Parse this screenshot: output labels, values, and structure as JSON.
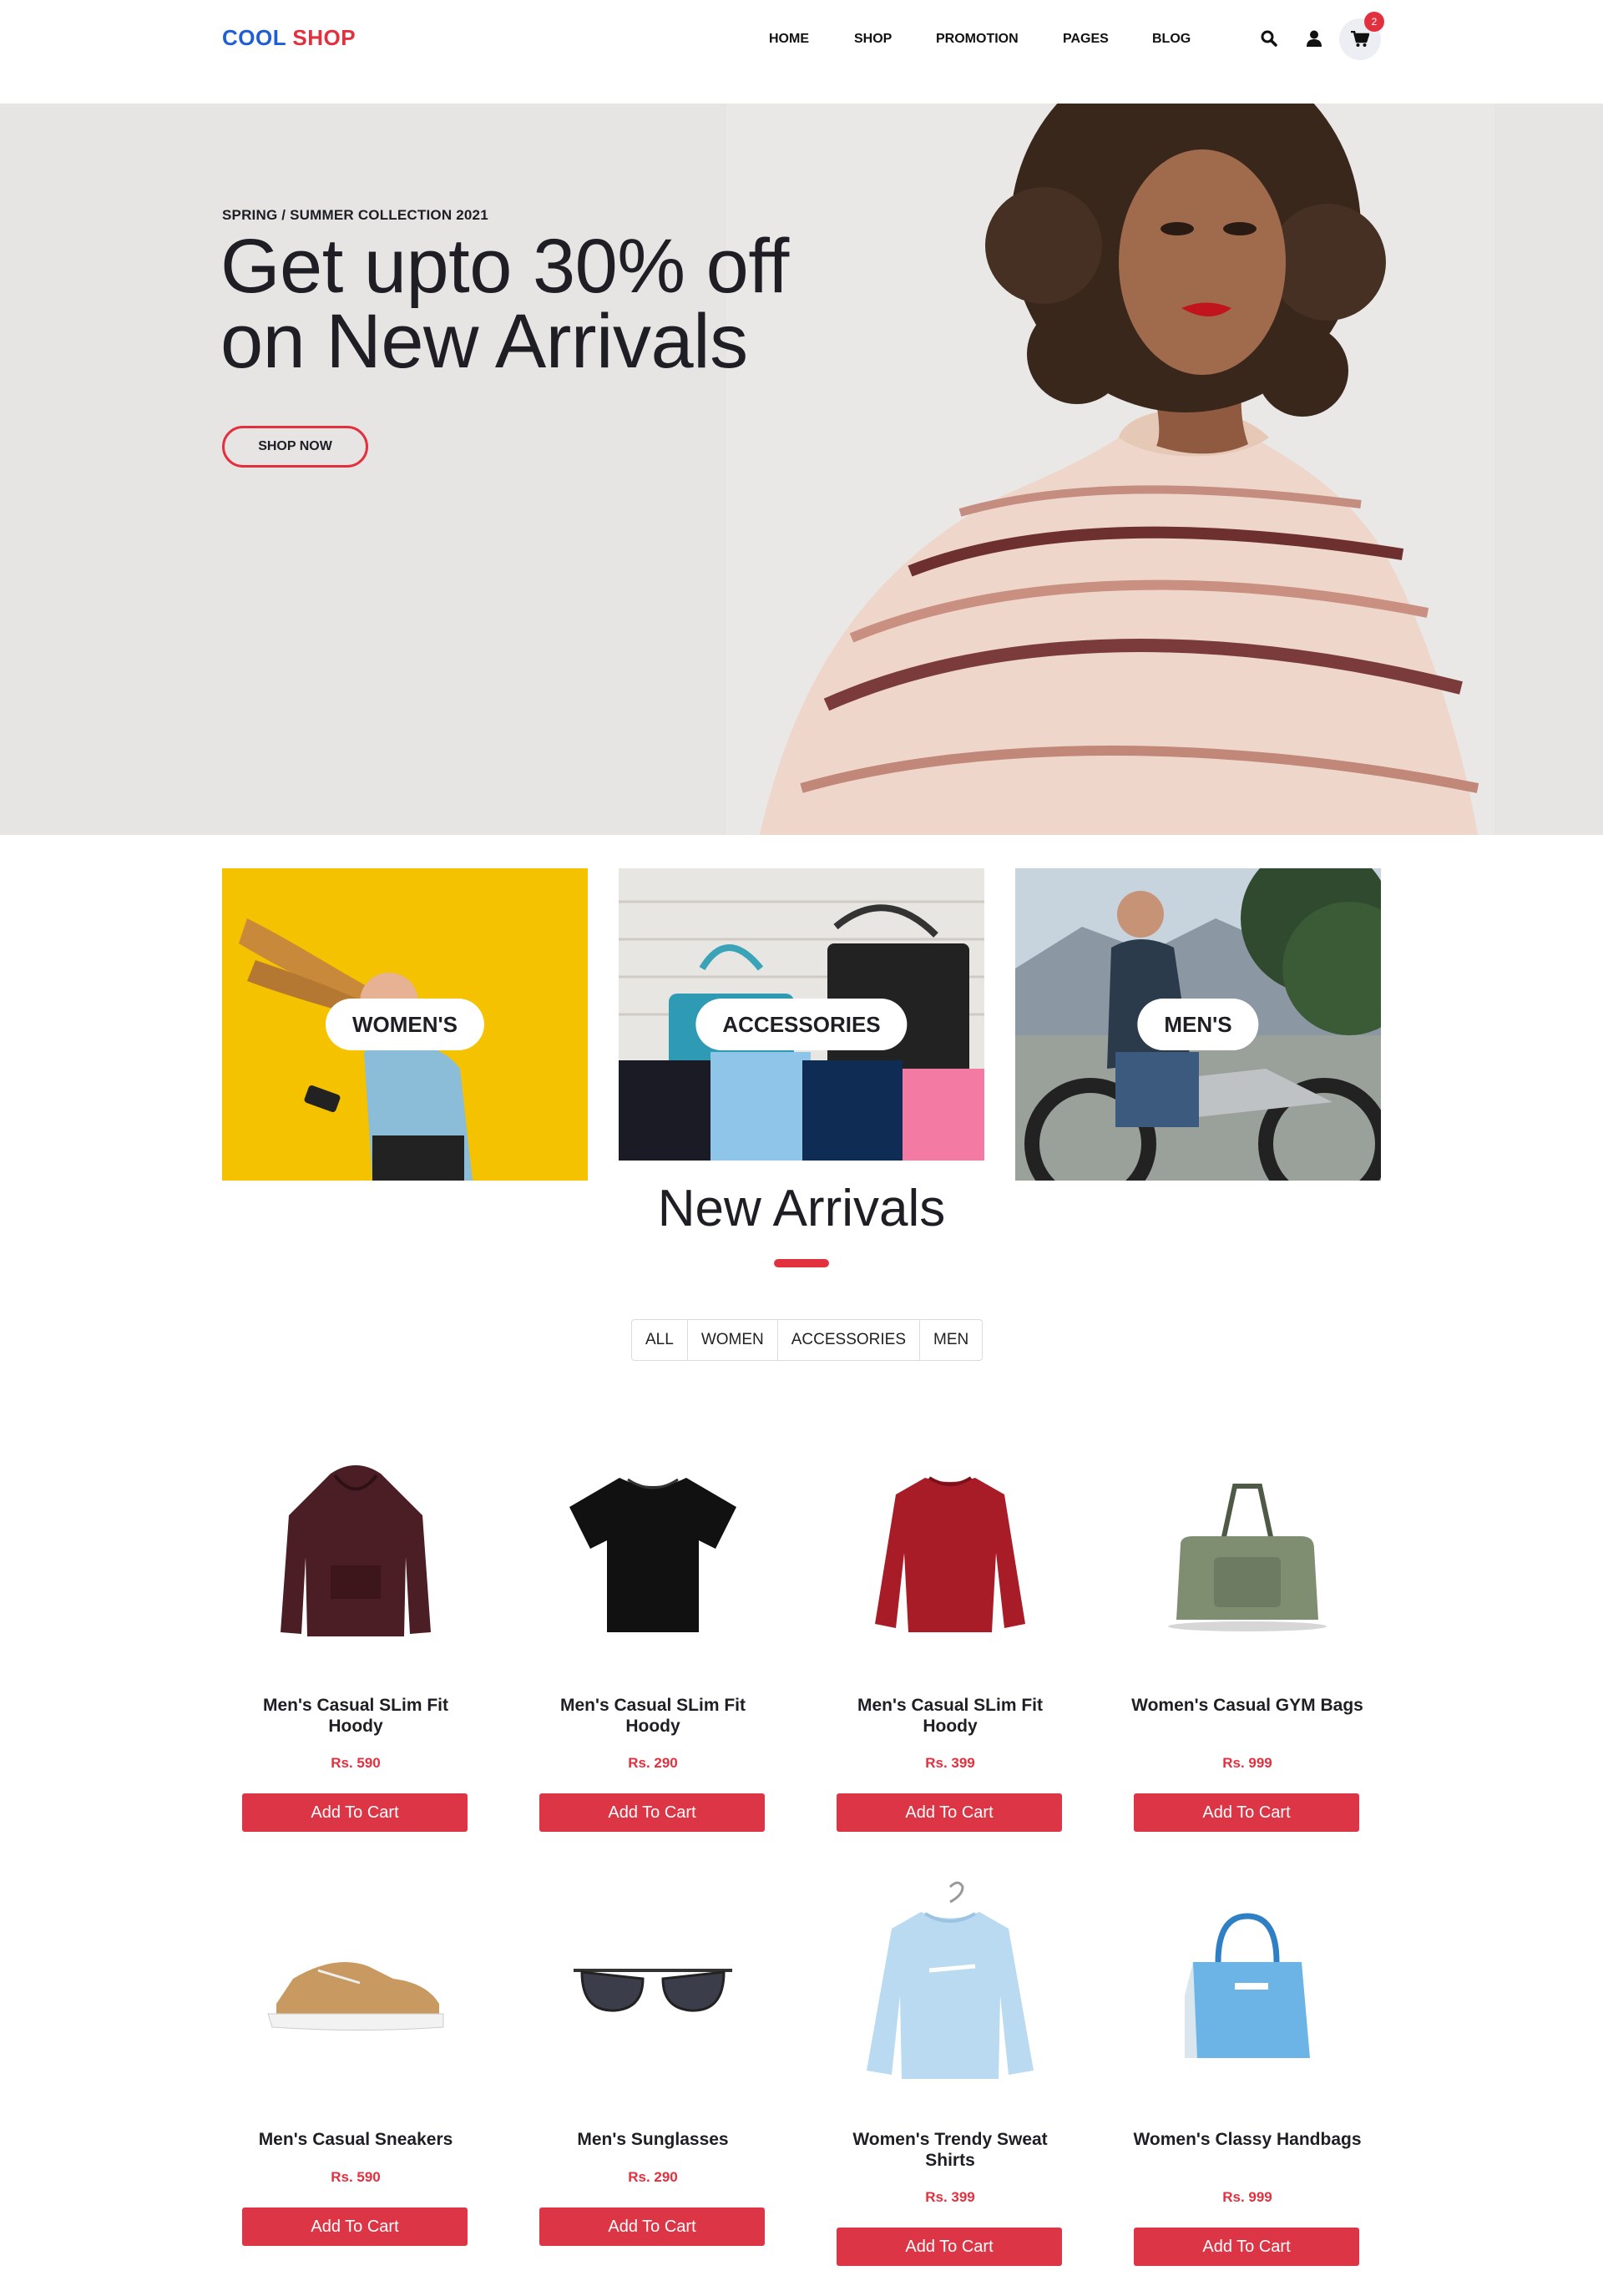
{
  "header": {
    "logo_part1": "COOL",
    "logo_part2": "SHOP",
    "nav": [
      "HOME",
      "SHOP",
      "PROMOTION",
      "PAGES",
      "BLOG"
    ],
    "cart_count": "2",
    "icons": [
      "search-icon",
      "user-icon",
      "cart-icon"
    ]
  },
  "hero": {
    "subtitle": "SPRING / SUMMER COLLECTION 2021",
    "title_line1": "Get upto 30% off",
    "title_line2": "on New Arrivals",
    "cta": "SHOP NOW"
  },
  "categories": [
    "WOMEN'S",
    "ACCESSORIES",
    "MEN'S"
  ],
  "arrivals": {
    "title": "New Arrivals",
    "filters": [
      "ALL",
      "WOMEN",
      "ACCESSORIES",
      "MEN"
    ],
    "add_label": "Add To Cart",
    "products": [
      {
        "name": "Men's Casual SLim Fit Hoody",
        "price": "Rs. 590",
        "image": "hoody"
      },
      {
        "name": "Men's Casual SLim Fit Hoody",
        "price": "Rs. 290",
        "image": "tshirt"
      },
      {
        "name": "Men's Casual SLim Fit Hoody",
        "price": "Rs. 399",
        "image": "sweater"
      },
      {
        "name": "Women's Casual GYM Bags",
        "price": "Rs. 999",
        "image": "gym-bag"
      },
      {
        "name": "Men's Casual Sneakers",
        "price": "Rs. 590",
        "image": "sneaker"
      },
      {
        "name": "Men's Sunglasses",
        "price": "Rs. 290",
        "image": "sunglasses"
      },
      {
        "name": "Women's Trendy Sweat Shirts",
        "price": "Rs. 399",
        "image": "sweatshirt"
      },
      {
        "name": "Women's Classy Handbags",
        "price": "Rs. 999",
        "image": "handbag"
      }
    ]
  },
  "colors": {
    "accent": "#e3303f",
    "brand_blue": "#1f5fd6",
    "button_red": "#dc3545",
    "hero_bg": "#e6e5e4",
    "women_bg": "#f5c200"
  }
}
